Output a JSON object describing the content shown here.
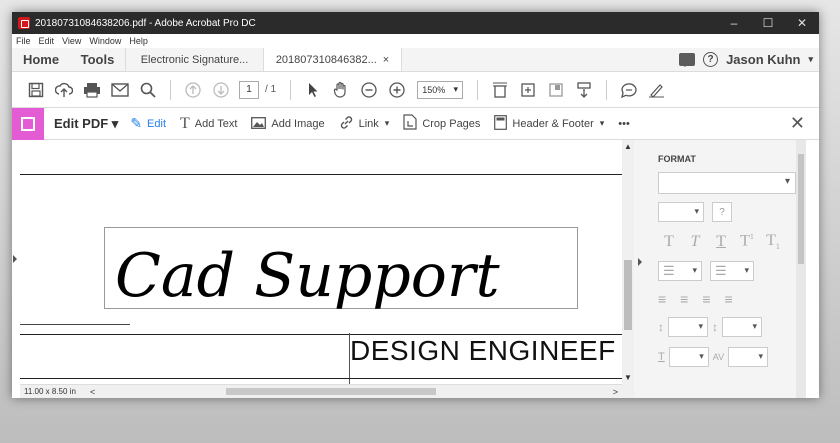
{
  "window": {
    "title": "20180731084638206.pdf - Adobe Acrobat Pro DC",
    "minimize": "–",
    "maximize": "☐",
    "close": "✕"
  },
  "menu": [
    "File",
    "Edit",
    "View",
    "Window",
    "Help"
  ],
  "tabs": {
    "home": "Home",
    "tools": "Tools",
    "doc1": "Electronic Signature...",
    "doc2": "201807310846382...",
    "doc2_close": "×"
  },
  "user": {
    "name": "Jason Kuhn",
    "help": "?"
  },
  "toolbar": {
    "page_current": "1",
    "page_total": "/ 1",
    "zoom": "150%"
  },
  "edit_bar": {
    "title": "Edit PDF",
    "items": {
      "edit": "Edit",
      "add_text": "Add Text",
      "add_image": "Add Image",
      "link": "Link",
      "crop_pages": "Crop Pages",
      "header_footer": "Header & Footer",
      "more": "•••"
    },
    "close": "✕"
  },
  "document": {
    "signature_text": "Cad Support",
    "design_text": "DESIGN ENGINEEF"
  },
  "format_panel": {
    "title": "FORMAT",
    "help": "?"
  },
  "status": {
    "page_size": "11.00 x 8.50 in",
    "scroll_left": "<",
    "scroll_right": ">"
  },
  "colors": {
    "edit_accent": "#e35cd3",
    "link_blue": "#2680eb",
    "titlebar": "#2b2b2b"
  }
}
